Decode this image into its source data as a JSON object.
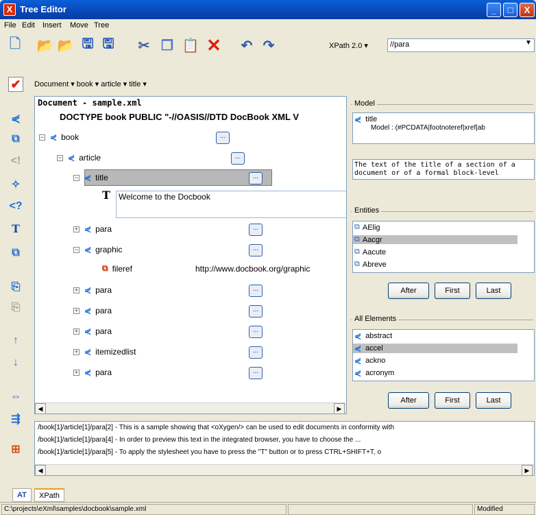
{
  "window": {
    "title": "Tree Editor",
    "app_icon": "X",
    "minimize": "_",
    "maximize": "□",
    "close": "X"
  },
  "menu": [
    "File",
    "Edit",
    "Insert",
    "Move",
    "Tree"
  ],
  "toolbar": {
    "xpath_version": "XPath 2.0 ▾",
    "xpath_value": "//para"
  },
  "breadcrumb": "Document ▾  book ▾  article ▾  title ▾",
  "editor": {
    "doc_title": "Document - sample.xml",
    "doctype": "DOCTYPE book PUBLIC \"-//OASIS//DTD DocBook XML V",
    "nodes": {
      "book": "book",
      "article": "article",
      "title": "title",
      "text_value": "Welcome to the Docbook",
      "para1": "para",
      "graphic": "graphic",
      "fileref": "fileref",
      "fileref_value": "http://www.docbook.org/graphic",
      "para2": "para",
      "para3": "para",
      "para4": "para",
      "itemizedlist": "itemizedlist",
      "para5": "para"
    },
    "dots": "..."
  },
  "model": {
    "title": "Model",
    "element": "title",
    "content_model": "Model : (#PCDATA|footnoteref|xref|ab",
    "doc": "The text of the title of a section of a document or of a formal block-level"
  },
  "entities": {
    "title": "Entities",
    "items": [
      "AElig",
      "Aacgr",
      "Aacute",
      "Abreve"
    ],
    "selected": 1,
    "buttons": [
      "After",
      "First",
      "Last"
    ]
  },
  "all_elements": {
    "title": "All Elements",
    "items": [
      "abstract",
      "accel",
      "ackno",
      "acronym"
    ],
    "selected": 1,
    "buttons": [
      "After",
      "First",
      "Last"
    ]
  },
  "results": [
    "/book[1]/article[1]/para[2] - This is a sample showing that <oXygen/> can be used          to edit documents in conformity with",
    "/book[1]/article[1]/para[4] - In order to preview this text in the integrated browser,               you have to choose the          ...",
    "/book[1]/article[1]/para[5] - To apply the stylesheet you have to press the          \"T\" button or to press CTRL+SHIFT+T, o"
  ],
  "tabs": [
    "AT",
    "XPath"
  ],
  "status": {
    "path": "C:\\projects\\eXml\\samples\\docbook\\sample.xml",
    "middle": "",
    "state": "Modified"
  }
}
